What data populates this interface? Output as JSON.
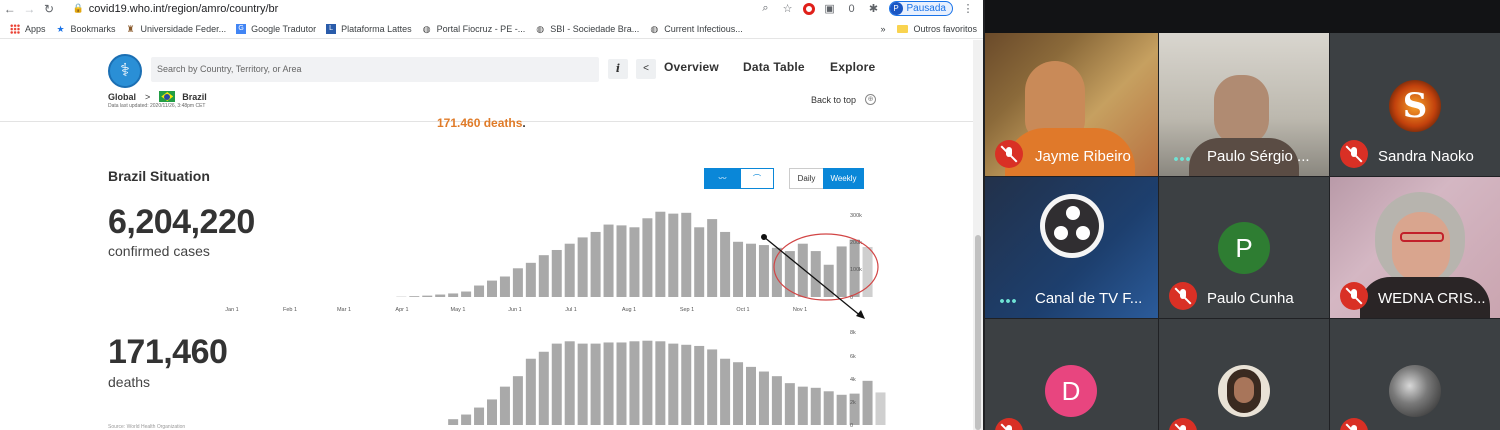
{
  "browser": {
    "url": "covid19.who.int/region/amro/country/br",
    "nav": {
      "back": "←",
      "forward": "→",
      "reload": "↻"
    },
    "profile_initial": "P",
    "profile_label": "Pausada",
    "bookmarks": [
      {
        "label": "Apps",
        "icon": "apps-grid-icon"
      },
      {
        "label": "Bookmarks",
        "icon": "star-icon"
      },
      {
        "label": "Universidade Feder...",
        "icon": "university-icon"
      },
      {
        "label": "Google Tradutor",
        "icon": "translate-icon"
      },
      {
        "label": "Plataforma Lattes",
        "icon": "lattes-icon"
      },
      {
        "label": "Portal Fiocruz - PE -...",
        "icon": "globe-icon"
      },
      {
        "label": "SBI - Sociedade Bra...",
        "icon": "globe-icon"
      },
      {
        "label": "Current Infectious...",
        "icon": "globe-icon"
      }
    ],
    "other_bookmarks": "Outros favoritos",
    "more": "»"
  },
  "who": {
    "search_placeholder": "Search by Country, Territory, or Area",
    "info_glyph": "i",
    "share_glyph": "<",
    "nav": {
      "overview": "Overview",
      "data_table": "Data Table",
      "explore": "Explore"
    },
    "breadcrumb": {
      "global": "Global",
      "sep": ">",
      "country": "Brazil"
    },
    "last_updated": "Data last updated: 2020/11/26, 3:48pm CET",
    "back_to_top": "Back to top",
    "deaths_highlight": "171.460 deaths",
    "deaths_highlight_dot": ".",
    "situation_title": "Brazil Situation",
    "toggles": {
      "linear": "〰",
      "log": "⌒",
      "daily": "Daily",
      "weekly": "Weekly"
    },
    "confirmed_cases": "6,204,220",
    "confirmed_label": "confirmed cases",
    "deaths": "171,460",
    "deaths_label": "deaths",
    "source": "Source: World Health Organization"
  },
  "chart_data": [
    {
      "type": "bar",
      "title": "confirmed cases",
      "x_tick_labels": [
        "Jan 1",
        "Feb 1",
        "Mar 1",
        "Apr 1",
        "May 1",
        "Jun 1",
        "Jul 1",
        "Aug 1",
        "Sep 1",
        "Oct 1",
        "Nov 1"
      ],
      "y_tick_labels": [
        "300k",
        "200k",
        "100k",
        "0"
      ],
      "ylim": [
        0,
        300000
      ],
      "values": [
        0,
        0,
        0,
        0,
        0,
        0,
        0,
        0,
        0,
        0,
        0,
        0,
        0,
        1000,
        3000,
        5000,
        9000,
        13000,
        20000,
        42000,
        60000,
        75000,
        105000,
        125000,
        153000,
        172000,
        195000,
        218000,
        238000,
        265000,
        262000,
        255000,
        288000,
        312000,
        305000,
        308000,
        255000,
        285000,
        238000,
        202000,
        195000,
        190000,
        180000,
        168000,
        195000,
        168000,
        118000,
        185000,
        210000,
        183000
      ]
    },
    {
      "type": "bar",
      "title": "deaths",
      "y_tick_labels": [
        "8k",
        "6k",
        "4k",
        "2k",
        "0"
      ],
      "ylim": [
        0,
        8000
      ],
      "values": [
        0,
        0,
        0,
        0,
        0,
        0,
        0,
        0,
        0,
        0,
        0,
        0,
        0,
        0,
        0,
        0,
        0,
        500,
        900,
        1500,
        2200,
        3300,
        4200,
        5700,
        6300,
        7000,
        7200,
        7000,
        7000,
        7100,
        7100,
        7200,
        7250,
        7200,
        7000,
        6900,
        6800,
        6500,
        5700,
        5400,
        5000,
        4600,
        4200,
        3600,
        3300,
        3200,
        2900,
        2600,
        2700,
        3800,
        2800
      ]
    }
  ],
  "meeting": {
    "participants": [
      {
        "name": "Jayme Ribeiro",
        "muted": true
      },
      {
        "name": "Paulo Sérgio ...",
        "speaking": true
      },
      {
        "name": "Sandra Naoko",
        "muted": true,
        "avatar": "S"
      },
      {
        "name": "Canal de TV F...",
        "speaking": true
      },
      {
        "name": "Paulo Cunha",
        "muted": true,
        "avatar": "P"
      },
      {
        "name": "WEDNA CRIS...",
        "muted": true
      },
      {
        "name": "",
        "avatar": "D"
      },
      {
        "name": ""
      },
      {
        "name": ""
      }
    ],
    "colors": {
      "muted_red": "#d93025",
      "avatar_green": "#2e7d32",
      "avatar_pink": "#e8457f"
    }
  }
}
